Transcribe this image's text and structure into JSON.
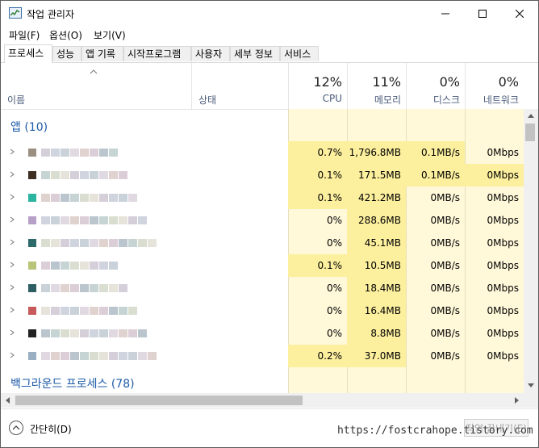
{
  "window": {
    "title": "작업 관리자"
  },
  "menu": [
    {
      "label": "파일(F)"
    },
    {
      "label": "옵션(O)"
    },
    {
      "label": "보기(V)"
    }
  ],
  "tabs": [
    {
      "label": "프로세스",
      "active": true
    },
    {
      "label": "성능"
    },
    {
      "label": "앱 기록"
    },
    {
      "label": "시작프로그램"
    },
    {
      "label": "사용자"
    },
    {
      "label": "세부 정보"
    },
    {
      "label": "서비스"
    }
  ],
  "columns": {
    "name": "이름",
    "status": "상태",
    "cpu": {
      "pct": "12%",
      "label": "CPU"
    },
    "memory": {
      "pct": "11%",
      "label": "메모리"
    },
    "disk": {
      "pct": "0%",
      "label": "디스크"
    },
    "network": {
      "pct": "0%",
      "label": "네트워크"
    }
  },
  "groups": {
    "apps": "앱 (10)",
    "background": "백그라운드 프로세스 (78)"
  },
  "rows": [
    {
      "cpu": "0.7%",
      "mem": "1,796.8MB",
      "disk": "0.1MB/s",
      "net": "0Mbps",
      "hl": [
        true,
        true,
        true,
        false
      ]
    },
    {
      "cpu": "0.1%",
      "mem": "171.5MB",
      "disk": "0.1MB/s",
      "net": "0Mbps",
      "hl": [
        true,
        true,
        true,
        true
      ]
    },
    {
      "cpu": "0.1%",
      "mem": "421.2MB",
      "disk": "0MB/s",
      "net": "0Mbps",
      "hl": [
        true,
        true,
        false,
        false
      ]
    },
    {
      "cpu": "0%",
      "mem": "288.6MB",
      "disk": "0MB/s",
      "net": "0Mbps",
      "hl": [
        false,
        true,
        false,
        false
      ]
    },
    {
      "cpu": "0%",
      "mem": "45.1MB",
      "disk": "0MB/s",
      "net": "0Mbps",
      "hl": [
        false,
        true,
        false,
        false
      ]
    },
    {
      "cpu": "0.1%",
      "mem": "10.5MB",
      "disk": "0MB/s",
      "net": "0Mbps",
      "hl": [
        true,
        true,
        false,
        false
      ]
    },
    {
      "cpu": "0%",
      "mem": "18.4MB",
      "disk": "0MB/s",
      "net": "0Mbps",
      "hl": [
        false,
        true,
        false,
        false
      ]
    },
    {
      "cpu": "0%",
      "mem": "16.4MB",
      "disk": "0MB/s",
      "net": "0Mbps",
      "hl": [
        false,
        true,
        false,
        false
      ]
    },
    {
      "cpu": "0%",
      "mem": "8.8MB",
      "disk": "0MB/s",
      "net": "0Mbps",
      "hl": [
        false,
        true,
        false,
        false
      ]
    },
    {
      "cpu": "0.2%",
      "mem": "37.0MB",
      "disk": "0MB/s",
      "net": "0Mbps",
      "hl": [
        true,
        true,
        false,
        false
      ]
    }
  ],
  "footer": {
    "fewer_details": "간단히(D)",
    "end_task": "작업 끝내기(E)"
  },
  "watermark": "https://fostcrahope.tistory.com",
  "colors": {
    "accent": "#1e5ba8",
    "heat_light": "#fff8d9",
    "heat_medium": "#fcef9e"
  }
}
